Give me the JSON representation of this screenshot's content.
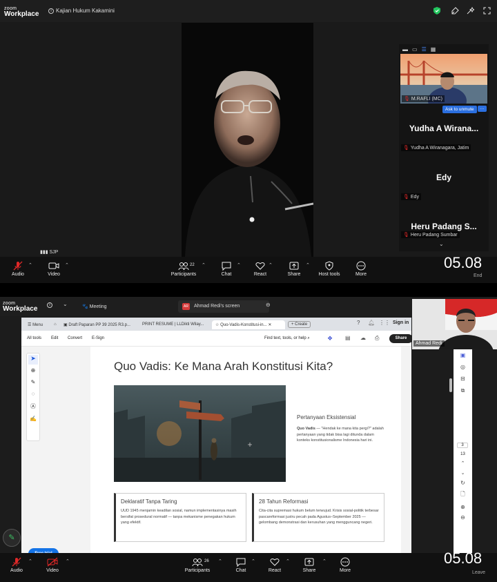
{
  "top_window": {
    "logo_small": "zoom",
    "logo_big": "Workplace",
    "meeting_title": "Kajian Hukum Kakamini",
    "speaker_label": "SJP",
    "gallery": [
      {
        "name": "M.RAFLI (MC)",
        "type": "video"
      },
      {
        "display": "Yudha A Wirana...",
        "name": "Yudha A Wiranagara, Jatim"
      },
      {
        "display": "Edy",
        "name": "Edy"
      },
      {
        "display": "Heru Padang S...",
        "name": "Heru Padang Sumbar"
      }
    ],
    "ask_unmute": "Ask to unmute",
    "toolbar": {
      "audio": "Audio",
      "video": "Video",
      "participants": "Participants",
      "participants_count": "22",
      "chat": "Chat",
      "react": "React",
      "share": "Share",
      "host_tools": "Host tools",
      "more": "More",
      "end": "End"
    },
    "clock": "05.08"
  },
  "bottom_window": {
    "logo_small": "zoom",
    "logo_big": "Workplace",
    "tabs": [
      "Meeting",
      "Ahmad Redi's screen"
    ],
    "tab_badge": "AR",
    "self_view_name": "Ahmad Redi",
    "browser": {
      "tabs": [
        "Menu",
        "Draft Paparan PP 39 2025 R3.p...",
        "PRINT RESUME | LLDikti Wilay...",
        "Quo-Vadis-Konstitusi-in...",
        "Create"
      ],
      "sign_in": "Sign in",
      "menu": [
        "All tools",
        "Edit",
        "Convert",
        "E-Sign"
      ],
      "search": "Find text, tools, or help",
      "share": "Share",
      "free_trial": "Free trial",
      "page_numbers": [
        "3",
        "13"
      ]
    },
    "document": {
      "title": "Quo Vadis: Ke Mana Arah Konstitusi Kita?",
      "section_heading": "Pertanyaan Eksistensial",
      "section_bold": "Quo Vadis",
      "section_body": " — \"Hendak ke mana kita pergi?\" adalah pertanyaan yang tidak bisa lagi ditunda dalam konteks konstitusionalisme Indonesia hari ini.",
      "card1_title": "Deklaratif Tanpa Taring",
      "card1_body": "UUD 1945 menjamin keadilan sosial, namun implementasinya masih bersifat prosedural normatif — tanpa mekanisme penegakan hukum yang efektif.",
      "card2_title": "28 Tahun Reformasi",
      "card2_body": "Cita-cita supremasi hukum belum terwujud. Krisis sosial-politik terbesar pascareformasi justru pecah pada Agustus–September 2025 — gelombang demonstrasi dan kerusuhan yang mengguncang negeri."
    },
    "toolbar": {
      "audio": "Audio",
      "video": "Video",
      "participants": "Participants",
      "participants_count": "26",
      "chat": "Chat",
      "react": "React",
      "share": "Share",
      "more": "More",
      "leave": "Leave"
    },
    "clock": "05.08"
  },
  "colors": {
    "accent": "#1473e6",
    "mute_red": "#e02828",
    "shield_green": "#22c55e"
  }
}
